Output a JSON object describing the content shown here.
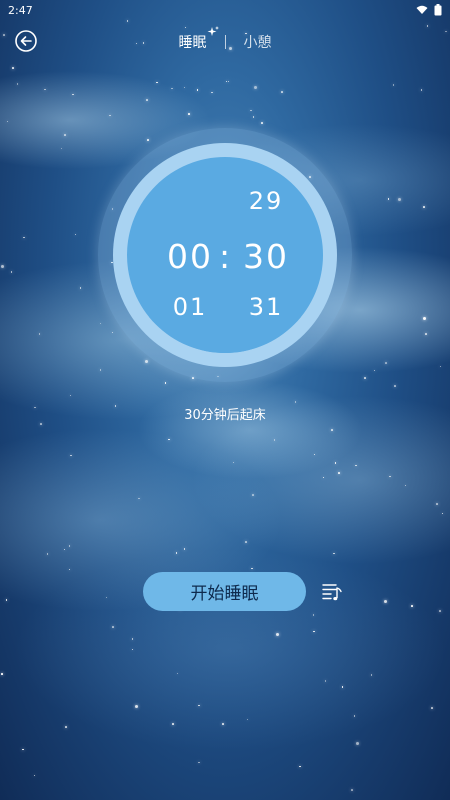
{
  "status_bar": {
    "time": "2:47"
  },
  "header": {
    "tabs": [
      {
        "label": "睡眠",
        "active": true
      },
      {
        "label": "小憩",
        "active": false
      }
    ]
  },
  "clock": {
    "hours": {
      "prev": "",
      "current": "00",
      "next": "01"
    },
    "minutes": {
      "prev": "29",
      "current": "30",
      "next": "31"
    },
    "separator": ":"
  },
  "wake_info": "30分钟后起床",
  "start_button": {
    "label": "开始睡眠"
  },
  "icons": {
    "back": "back-arrow-icon",
    "sparkle": "sparkle-icon",
    "music_list": "music-playlist-icon",
    "wifi": "wifi-icon",
    "battery": "battery-icon"
  },
  "colors": {
    "clock_face": "#5aaae2",
    "clock_ring": "#a9d3f2",
    "button": "#6fb8e8",
    "button_text": "#0e2a4d"
  }
}
